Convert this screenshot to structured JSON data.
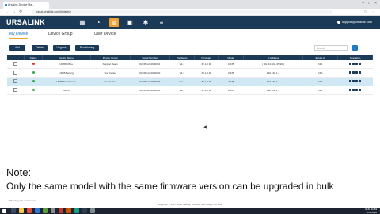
{
  "browser": {
    "tab_title": "Ursalink Device Ma...",
    "url": "cloud.ursalink.com/#!/device",
    "window_controls": [
      "–",
      "□",
      "×"
    ]
  },
  "app": {
    "logo": "URSALINK",
    "user": "support@ursalink.com",
    "nav_icons": [
      "dashboard-icon",
      "gauge-icon",
      "devices-icon",
      "task-icon",
      "settings-icon",
      "menu-icon"
    ]
  },
  "subnav": {
    "tabs": [
      {
        "label": "My Device",
        "active": true
      },
      {
        "label": "Device Group",
        "active": false
      },
      {
        "label": "User Device",
        "active": false
      }
    ]
  },
  "toolbar": {
    "add": "Add",
    "delete": "Delete",
    "upgrade": "Upgrade",
    "provisioning": "Provisioning",
    "search_placeholder": "Search"
  },
  "table": {
    "headers": [
      "",
      "Status",
      "Device Name",
      "Device Group",
      "Serial Number",
      "Hardware",
      "Firmware",
      "Model",
      "Ip Address",
      "Expire At",
      "Operation"
    ],
    "rows": [
      {
        "status": "red",
        "name": "UR35 Office",
        "group": "Support Team",
        "sn": "6216B1234000001",
        "hw": "V1.1",
        "fw": "32.1.0.96",
        "model": "UR35",
        "ip": "[ 4G: 10.134.45.99 ]",
        "exp": "N/A",
        "selected": false
      },
      {
        "status": "green",
        "name": "UR35-Beijing",
        "group": "Test Center",
        "sn": "6216B1234000002",
        "hw": "V1.1",
        "fw": "32.1.0.96",
        "model": "UR35",
        "ip": "192.168.1.1",
        "exp": "N/A",
        "selected": false
      },
      {
        "status": "green",
        "name": "UR35 Test Device",
        "group": "Test Center",
        "sn": "6216B1234000003",
        "hw": "V1.1",
        "fw": "32.1.0.96",
        "model": "UR35",
        "ip": "192.168.1.1",
        "exp": "N/A",
        "selected": true
      },
      {
        "status": "green",
        "name": "Demo",
        "group": "",
        "sn": "6216B1234000004",
        "hw": "V1.1",
        "fw": "32.1.0.96",
        "model": "UR35",
        "ip": "192.168.1.1",
        "exp": "N/A",
        "selected": false
      }
    ]
  },
  "pagination": "Showing 1 to 4 of 4 rows",
  "copyright": "Copyright © 2017-2018 Xiamen Ursalink Technology Co., Ltd.",
  "note": {
    "title": "Note:",
    "text": "Only the same model with the same firmware version can be upgraded in bulk"
  },
  "taskbar": {
    "time": "11:59",
    "date": "6/19/2018",
    "lang": "ENG"
  }
}
